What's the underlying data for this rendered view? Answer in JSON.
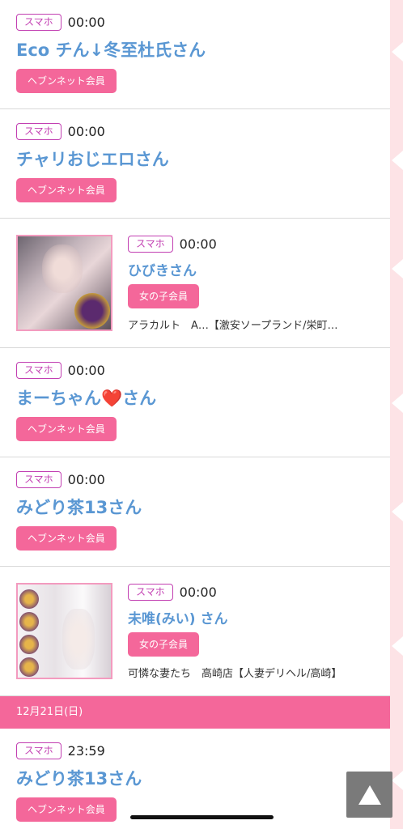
{
  "entries": [
    {
      "device": "スマホ",
      "time": "00:00",
      "name": "Eco チん↓冬至杜氏さん",
      "member": "ヘブンネット会員"
    },
    {
      "device": "スマホ",
      "time": "00:00",
      "name": "チャリおじエロさん",
      "member": "ヘブンネット会員"
    },
    {
      "device": "スマホ",
      "time": "00:00",
      "name": "ひびきさん",
      "member": "女の子会員",
      "shop": "アラカルト　A…【激安ソープランド/栄町…",
      "thumb": "ranking-photo"
    },
    {
      "device": "スマホ",
      "time": "00:00",
      "name": "まーちゃん❤️さん",
      "member": "ヘブンネット会員"
    },
    {
      "device": "スマホ",
      "time": "00:00",
      "name": "みどり茶13さん",
      "member": "ヘブンネット会員"
    },
    {
      "device": "スマホ",
      "time": "00:00",
      "name": "未唯(みい) さん",
      "member": "女の子会員",
      "shop": "可憐な妻たち　高崎店【人妻デリヘル/高崎】",
      "thumb": "profile-photo"
    }
  ],
  "date_header": "12月21日(日)",
  "last_entry": {
    "device": "スマホ",
    "time": "23:59",
    "name": "みどり茶13さん",
    "member": "ヘブンネット会員"
  },
  "colors": {
    "accent": "#f4679a",
    "name": "#5a97d3",
    "device": "#c23fb2",
    "stripe": "#fde3e6"
  },
  "icons": {
    "scroll_top": "triangle-up-icon"
  }
}
